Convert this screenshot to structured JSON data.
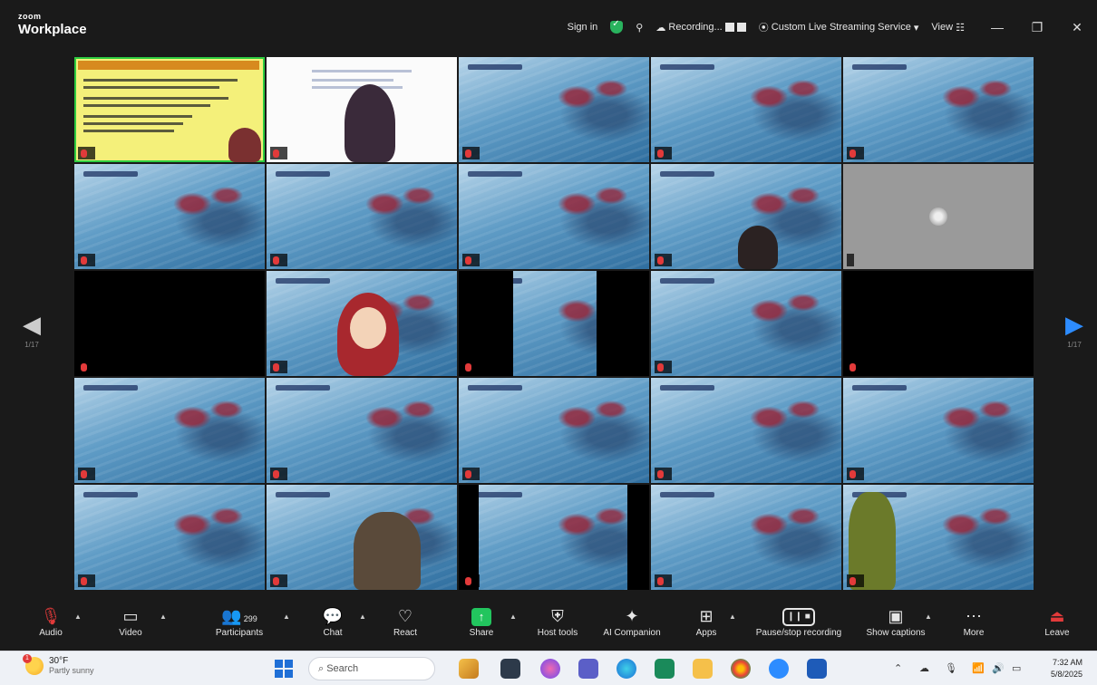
{
  "app": {
    "brand_small": "zoom",
    "brand_big": "Workplace"
  },
  "titlebar": {
    "sign_in": "Sign in",
    "recording": "Recording...",
    "livestream": "Custom Live Streaming Service",
    "view": "View",
    "minimize": "—",
    "restore": "❐",
    "close": "✕"
  },
  "colors": {
    "accent": "#2d8cff",
    "share": "#22c55e",
    "active_speaker": "#2ecc40",
    "muted": "#e23a3a"
  },
  "participants": [
    "",
    "",
    "",
    "",
    "",
    "",
    "",
    "",
    "",
    "",
    "",
    "",
    "",
    "",
    "",
    "",
    "",
    "",
    "",
    "",
    "",
    "",
    "",
    "",
    ""
  ],
  "nav": {
    "left_count": "1/17",
    "right_count": "1/17"
  },
  "toolbar": {
    "audio": "Audio",
    "video": "Video",
    "participants": "Participants",
    "participants_count": "299",
    "chat": "Chat",
    "react": "React",
    "share": "Share",
    "host_tools": "Host tools",
    "ai_companion": "AI Companion",
    "apps": "Apps",
    "recording": "Pause/stop recording",
    "captions": "Show captions",
    "more": "More",
    "leave": "Leave"
  },
  "taskbar": {
    "weather_temp": "30°F",
    "weather_desc": "Partly sunny",
    "search_placeholder": "Search",
    "time": "7:32 AM",
    "date": "5/8/2025"
  }
}
